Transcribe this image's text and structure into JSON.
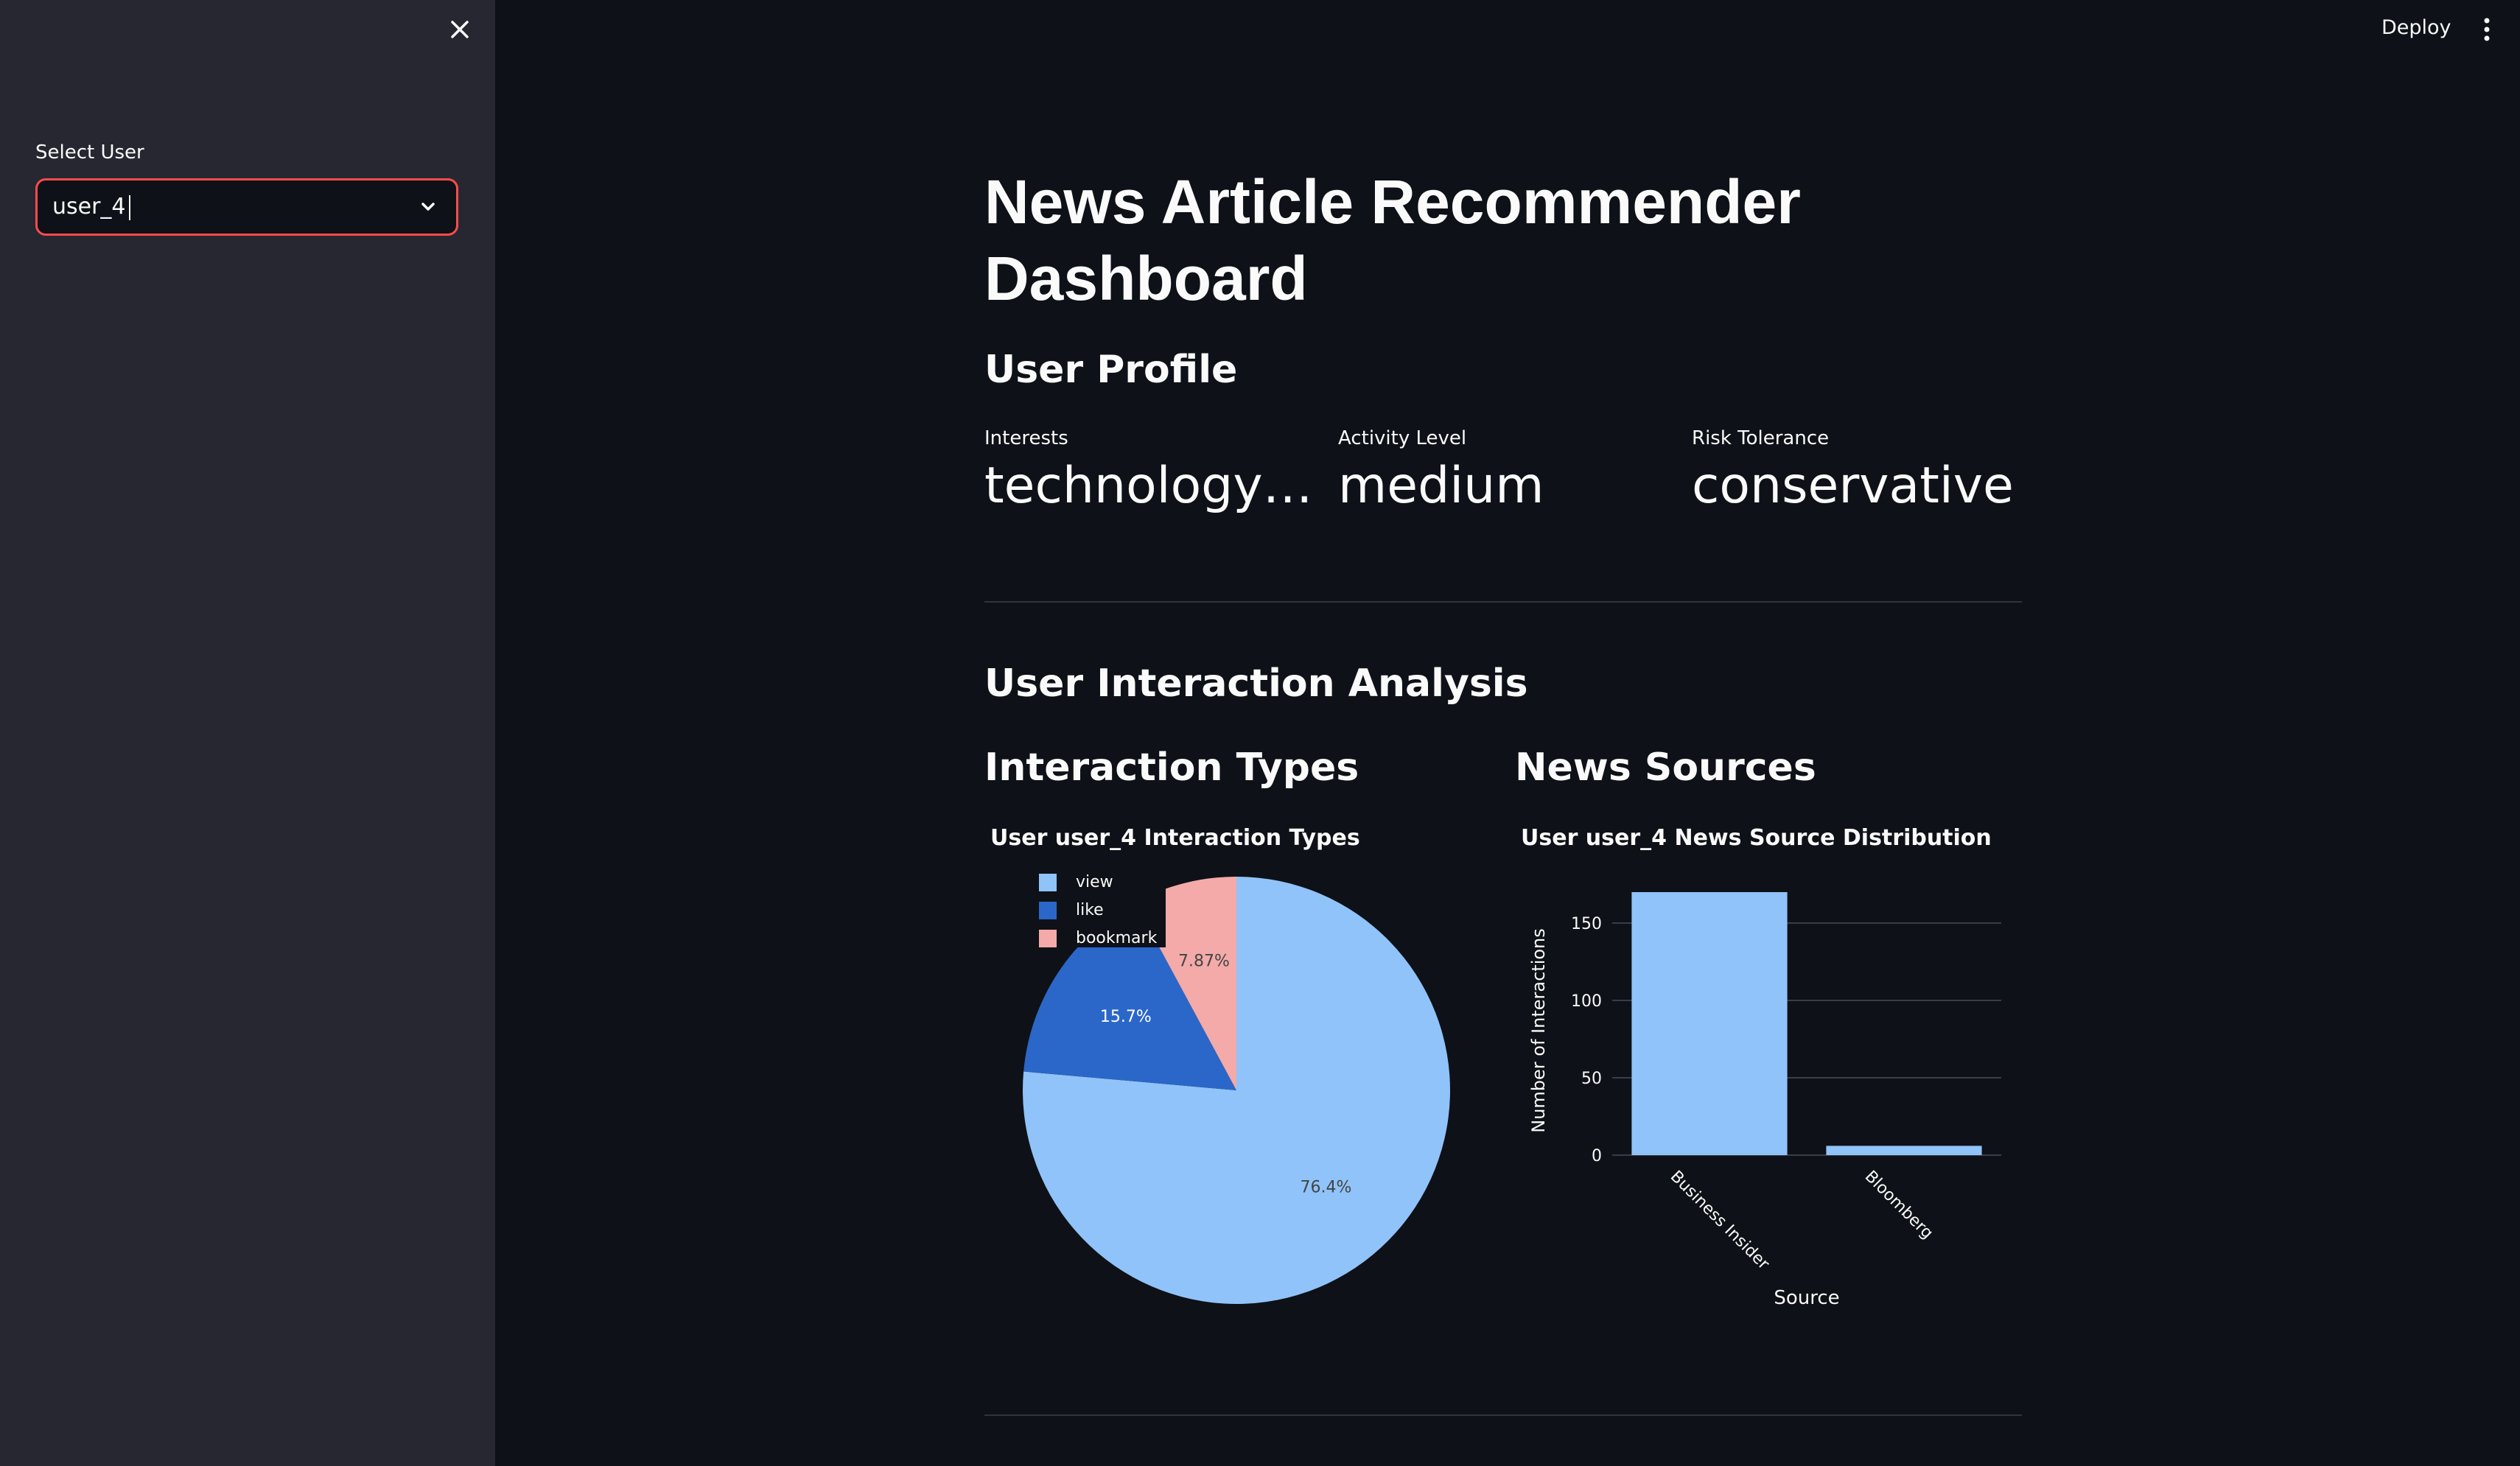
{
  "sidebar": {
    "select_label": "Select User",
    "select_value": "user_4"
  },
  "header": {
    "deploy_label": "Deploy"
  },
  "main": {
    "title": "News Article Recommender Dashboard",
    "profile_heading": "User Profile",
    "metrics": [
      {
        "label": "Interests",
        "value": "technology,r…"
      },
      {
        "label": "Activity Level",
        "value": "medium"
      },
      {
        "label": "Risk Tolerance",
        "value": "conservative"
      }
    ],
    "analysis_heading": "User Interaction Analysis",
    "interaction_heading": "Interaction Types",
    "sources_heading": "News Sources"
  },
  "colors": {
    "accent": "#ff4b4b",
    "view": "#90c3f9",
    "like": "#2b67c8",
    "bookmark": "#f3aaa8"
  },
  "chart_data": [
    {
      "type": "pie",
      "title": "User user_4 Interaction Types",
      "slices": [
        {
          "label": "view",
          "value": 76.4,
          "text": "76.4%"
        },
        {
          "label": "like",
          "value": 15.73,
          "text": "15.7%"
        },
        {
          "label": "bookmark",
          "value": 7.87,
          "text": "7.87%"
        }
      ],
      "legend": [
        "view",
        "like",
        "bookmark"
      ],
      "legend_position": "top-left"
    },
    {
      "type": "bar",
      "title": "User user_4 News Source Distribution",
      "categories": [
        "Business Insider",
        "Bloomberg"
      ],
      "values": [
        170,
        6
      ],
      "xlabel": "Source",
      "ylabel": "Number of Interactions",
      "yticks": [
        0,
        50,
        100,
        150
      ],
      "ylim": [
        0,
        180
      ],
      "grid": true
    }
  ]
}
